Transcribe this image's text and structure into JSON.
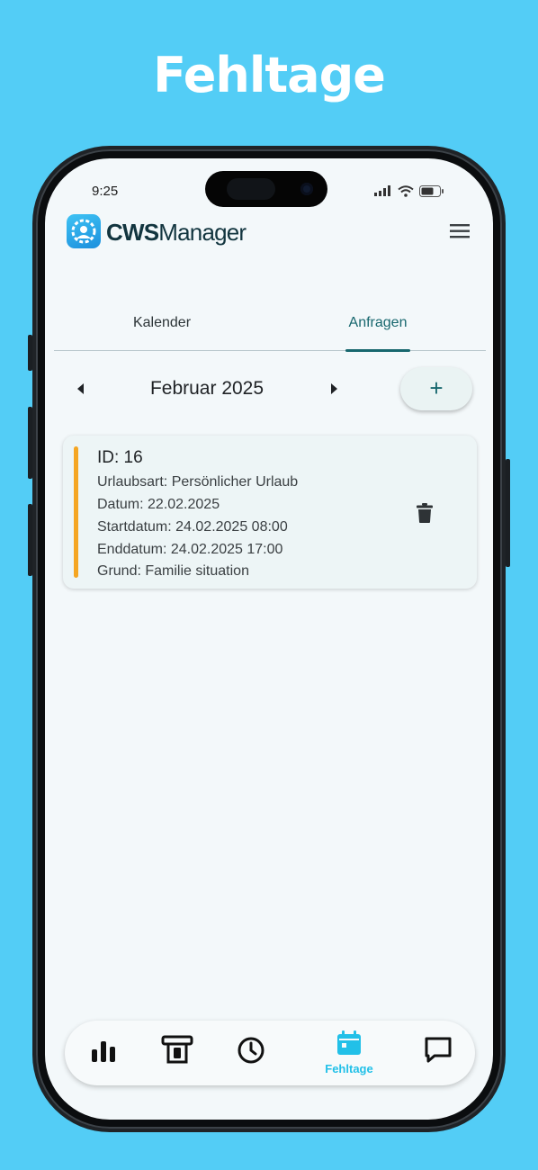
{
  "banner": {
    "title": "Fehltage"
  },
  "status_bar": {
    "time": "9:25"
  },
  "header": {
    "logo_bold": "CWS",
    "logo_light": "Manager"
  },
  "tabs": [
    {
      "label": "Kalender",
      "active": false
    },
    {
      "label": "Anfragen",
      "active": true
    }
  ],
  "month_nav": {
    "label": "Februar 2025",
    "add_label": "+"
  },
  "requests": [
    {
      "id_line": "ID: 16",
      "lines": [
        "Urlaubsart: Persönlicher Urlaub",
        "Datum: 22.02.2025",
        "Startdatum: 24.02.2025 08:00",
        "Enddatum: 24.02.2025 17:00",
        "Grund: Familie situation"
      ],
      "status_color": "#f5a623"
    }
  ],
  "bottom_nav": {
    "items": [
      {
        "icon": "bar-chart-icon",
        "label": ""
      },
      {
        "icon": "cash-register-icon",
        "label": ""
      },
      {
        "icon": "clock-icon",
        "label": ""
      },
      {
        "icon": "calendar-icon",
        "label": "Fehltage",
        "active": true
      },
      {
        "icon": "chat-icon",
        "label": ""
      }
    ]
  },
  "colors": {
    "background": "#53cdf6",
    "accent": "#17676e",
    "active_nav": "#22c0e8",
    "pending": "#f5a623"
  }
}
